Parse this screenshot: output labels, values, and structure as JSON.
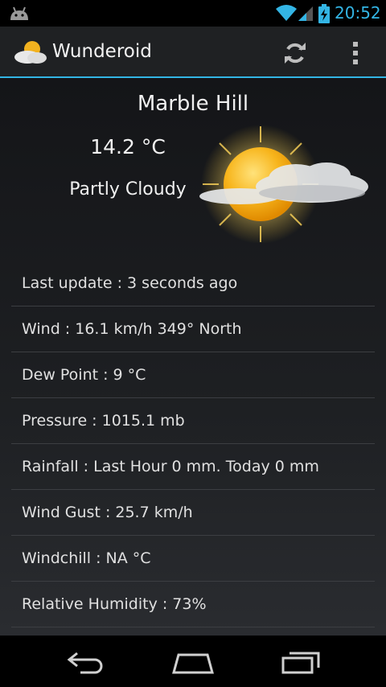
{
  "status_bar": {
    "time": "20:52",
    "icons": [
      "android-icon",
      "wifi-icon",
      "signal-icon",
      "battery-charging-icon"
    ],
    "accent_color": "#33b5e5"
  },
  "action_bar": {
    "app_title": "Wunderoid",
    "icons": [
      "partly-cloudy-icon",
      "refresh-icon",
      "overflow-menu-icon"
    ]
  },
  "weather": {
    "location": "Marble Hill",
    "temperature": "14.2 °C",
    "condition": "Partly Cloudy",
    "icon": "sun-behind-cloud-icon"
  },
  "details": [
    "Last update :  3 seconds ago",
    "Wind : 16.1 km/h 349° North",
    "Dew Point : 9 °C",
    "Pressure : 1015.1 mb",
    "Rainfall : Last Hour 0 mm. Today 0 mm",
    "Wind Gust : 25.7 km/h",
    "Windchill : NA °C",
    "Relative Humidity : 73%"
  ],
  "nav_bar": {
    "icons": [
      "back-icon",
      "home-icon",
      "recents-icon"
    ]
  }
}
